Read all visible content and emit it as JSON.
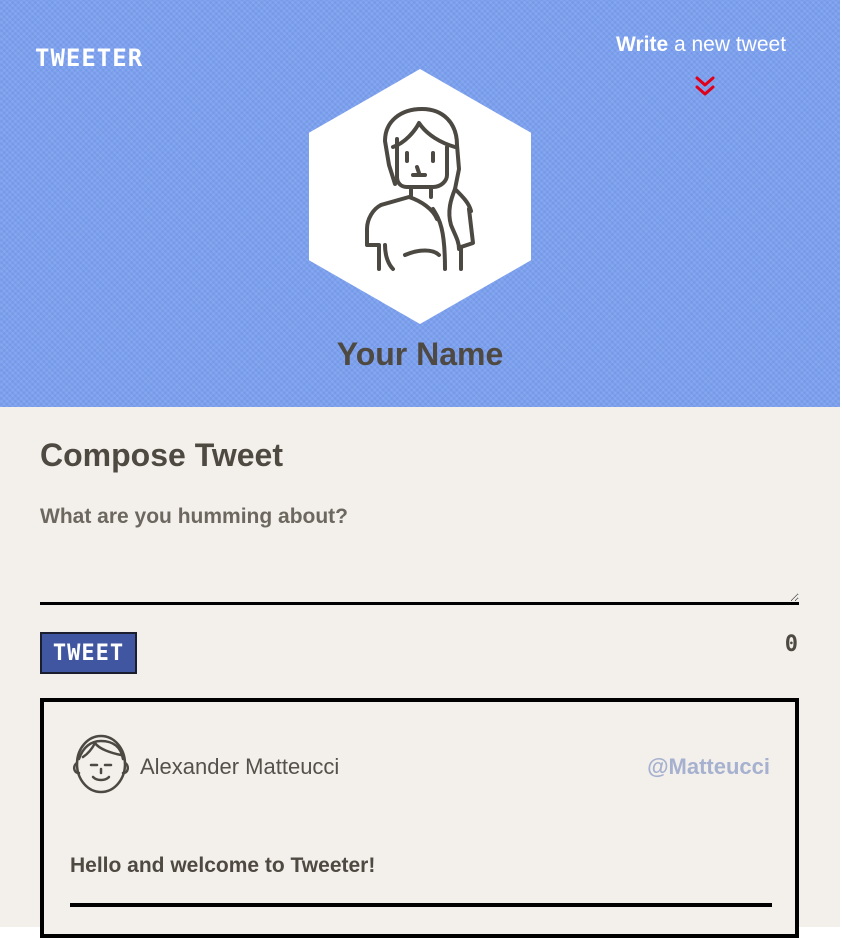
{
  "header": {
    "brand": "TWEETER",
    "write_strong": "Write",
    "write_rest": " a new tweet",
    "accent_color": "#e0001a",
    "background_color": "#7a9ff0",
    "profile_name": "Your Name"
  },
  "compose": {
    "title": "Compose Tweet",
    "placeholder": "What are you humming about?",
    "button_label": "TWEET",
    "char_count": "0"
  },
  "tweets": [
    {
      "author_name": "Alexander Matteucci",
      "handle": "@Matteucci",
      "text": "Hello and welcome to Tweeter!"
    }
  ]
}
